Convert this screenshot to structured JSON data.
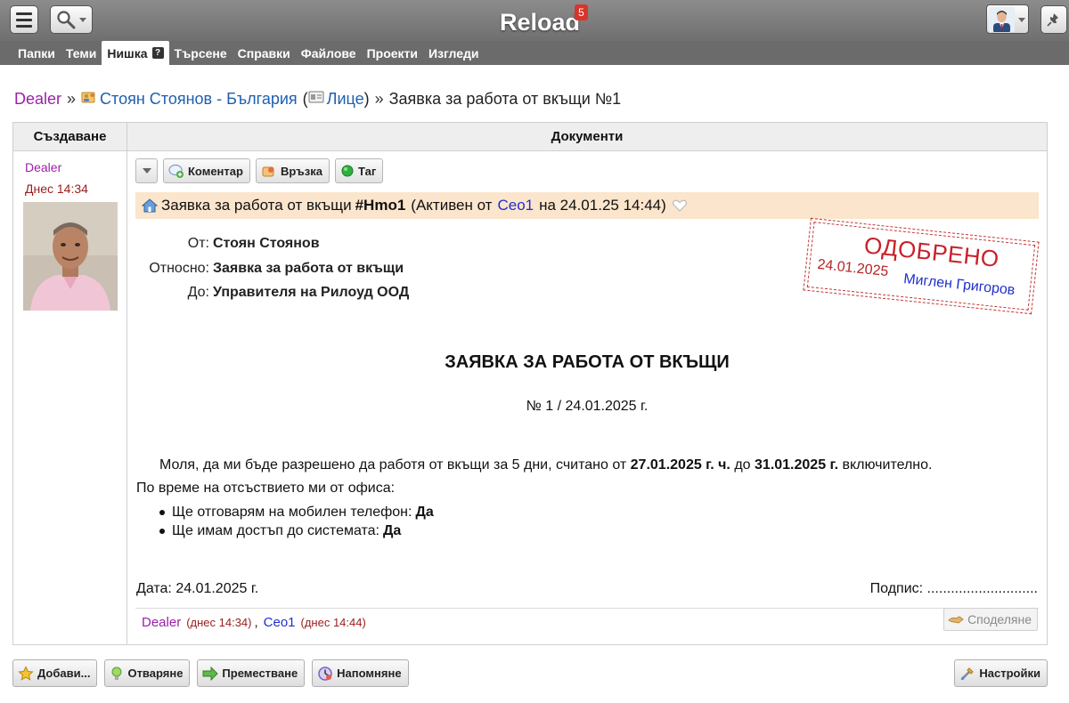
{
  "app": {
    "title": "Reload",
    "notification_count": "5"
  },
  "nav": {
    "tabs": [
      {
        "label": "Папки"
      },
      {
        "label": "Теми"
      },
      {
        "label": "Нишка",
        "active": true,
        "help": "?"
      },
      {
        "label": "Търсене"
      },
      {
        "label": "Справки"
      },
      {
        "label": "Файлове"
      },
      {
        "label": "Проекти"
      },
      {
        "label": "Изгледи"
      }
    ]
  },
  "breadcrumb": {
    "root": "Dealer",
    "sep": "»",
    "contact": "Стоян Стоянов - България",
    "open_paren": "(",
    "category": "Лице",
    "close_paren": ")",
    "current": "Заявка за работа от вкъщи №1"
  },
  "table": {
    "col_left": "Създаване",
    "col_right": "Документи"
  },
  "creator": {
    "name": "Dealer",
    "time": "Днес 14:34"
  },
  "toolbar": {
    "comment": "Коментар",
    "link": "Връзка",
    "tag": "Таг"
  },
  "doc_strip": {
    "title": "Заявка за работа от вкъщи",
    "handle": "#Hmo1",
    "status_prefix": "(Активен от",
    "user": "Ceo1",
    "status_suffix": "на 24.01.25 14:44)"
  },
  "fields": {
    "from_label": "От:",
    "from_value": "Стоян Стоянов",
    "subject_label": "Относно:",
    "subject_value": "Заявка за работа от вкъщи",
    "to_label": "До:",
    "to_value": "Управителя на Рилоуд ООД"
  },
  "stamp": {
    "title": "ОДОБРЕНО",
    "date": "24.01.2025",
    "user": "Миглен Григоров"
  },
  "document": {
    "title": "ЗАЯВКА ЗА РАБОТА ОТ ВКЪЩИ",
    "number": "№ 1 / 24.01.2025 г.",
    "para_1": "Моля, да ми бъде разрешено да работя от вкъщи за 5 дни, считано от",
    "date_from": "27.01.2025 г. ч.",
    "para_mid": "до",
    "date_to": "31.01.2025 г.",
    "para_end": "включително.",
    "para_2": "По време на отсъствието ми от офиса:",
    "bullets": [
      {
        "text": "Ще отговарям на мобилен телефон:",
        "value": "Да"
      },
      {
        "text": "Ще имам достъп до системата:",
        "value": "Да"
      }
    ],
    "date_line": "Дата: 24.01.2025 г.",
    "sign_line": "Подпис: ............................"
  },
  "log": {
    "user1": "Dealer",
    "time1": "(днес 14:34)",
    "comma": ",",
    "user2": "Ceo1",
    "time2": "(днес 14:44)",
    "share": "Споделяне"
  },
  "bottom": {
    "add": "Добави...",
    "open": "Отваряне",
    "move": "Преместване",
    "remind": "Напомняне",
    "settings": "Настройки"
  }
}
